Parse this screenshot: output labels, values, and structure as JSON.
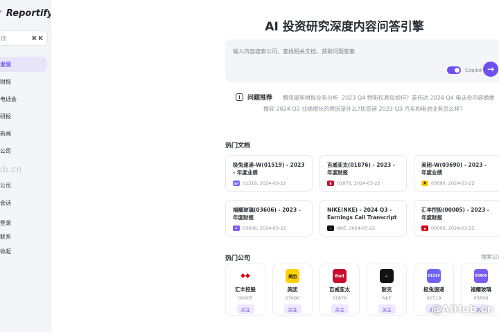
{
  "app": {
    "brand": "Reportify"
  },
  "sidebar": {
    "search_placeholder": "搜",
    "search_shortcut": "⌘ K",
    "items": [
      {
        "label": "发现"
      },
      {
        "label": "财报"
      },
      {
        "label": "电话会"
      },
      {
        "label": "研报"
      },
      {
        "label": "新闻"
      },
      {
        "label": "公司"
      },
      {
        "label": "公司"
      },
      {
        "label": "会话"
      },
      {
        "label": "登录"
      },
      {
        "label": "联系"
      },
      {
        "label": "收起"
      }
    ],
    "watermark": "ub.cn"
  },
  "main": {
    "title": "AI 投资研究深度内容问答引擎",
    "ask": {
      "placeholder": "输入内容搜索公司、查找相关文档、获取问题答案",
      "copilot_label": "Copilot",
      "send_icon": "arrow-right-icon"
    },
    "suggestions": {
      "label": "问题推荐",
      "questions": [
        "腾讯最新财报业务分析",
        "2023 Q4 特斯拉表现如何?",
        "英伟达 2024 Q4 电话会内容摘要",
        "微软 2024 Q2 业绩增长的原因是什么?",
        "比亚迪 2023 Q3 汽车和电池业务怎么样?"
      ]
    },
    "hot_docs": {
      "title": "热门文档",
      "items": [
        {
          "title": "极兔速递-W(01519) - 2023 - 年度业绩",
          "code_date": "01519, 2024-03-22",
          "logo_color": "#6d63f5",
          "logo_text": "J&T"
        },
        {
          "title": "百威亚太(01876) - 2023 - 年度财报",
          "code_date": "01876, 2024-03-22",
          "logo_color": "#c8102e",
          "logo_text": "B"
        },
        {
          "title": "美团-W(03690) - 2023 - 年度业绩",
          "code_date": "03690, 2024-03-22",
          "logo_color": "#ffd100",
          "logo_text": "美团"
        },
        {
          "title": "福耀玻璃(03606) - 2023 - 年度财报",
          "code_date": "03606, 2024-03-22",
          "logo_color": "#7a5cf0",
          "logo_text": "F"
        },
        {
          "title": "NIKE(NKE) - 2024 Q3 - Earnings Call Transcript",
          "code_date": "NKE, 2024-03-22",
          "logo_color": "#111111",
          "logo_text": "✓"
        },
        {
          "title": "汇丰控股(00005) - 2023 - 年度财报",
          "code_date": "00005, 2024-03-22",
          "logo_color": "#db0011",
          "logo_text": "◆"
        }
      ]
    },
    "hot_companies": {
      "title": "热门公司",
      "more": "搜索公司",
      "follow_label": "关注",
      "items": [
        {
          "name": "汇丰控股",
          "code": "00005",
          "logo_text": "◆◆",
          "logo_bg": "#ffffff",
          "logo_fg": "#db0011"
        },
        {
          "name": "美团",
          "code": "03690",
          "logo_text": "美团",
          "logo_bg": "#ffd100",
          "logo_fg": "#111111"
        },
        {
          "name": "百威亚太",
          "code": "01876",
          "logo_text": "Bud",
          "logo_bg": "#c8102e",
          "logo_fg": "#ffffff"
        },
        {
          "name": "耐克",
          "code": "NKE",
          "logo_text": "✓",
          "logo_bg": "#111111",
          "logo_fg": "#ffffff"
        },
        {
          "name": "极兔速递",
          "code": "01519",
          "logo_text": "01519",
          "logo_bg": "#6d63f5",
          "logo_fg": "#ffffff"
        },
        {
          "name": "福耀玻璃",
          "code": "03606",
          "logo_text": "03606",
          "logo_bg": "#7a5cf0",
          "logo_fg": "#ffffff"
        }
      ]
    },
    "watermark": "@AIHub.cn"
  }
}
